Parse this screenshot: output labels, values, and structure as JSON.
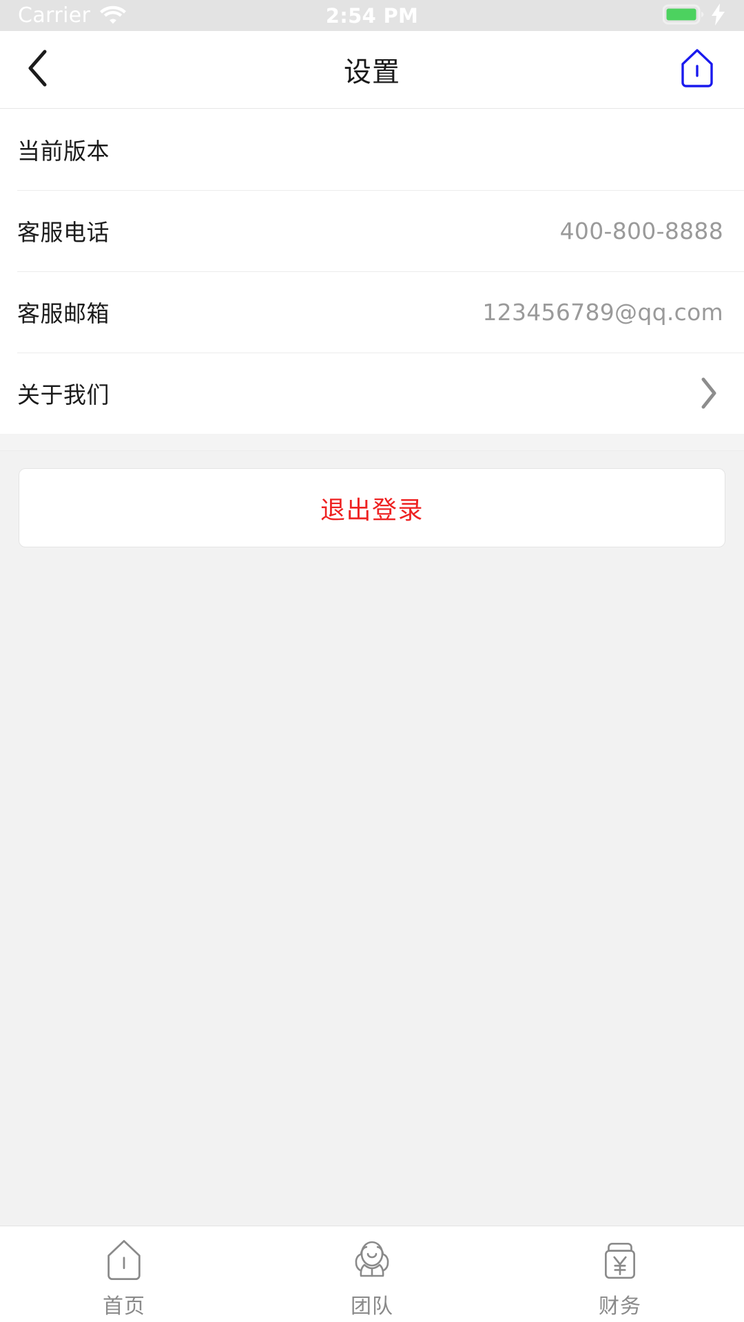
{
  "status_bar": {
    "carrier": "Carrier",
    "wifi_icon": "wifi-icon",
    "time": "2:54 PM",
    "battery_icon": "battery-full-icon",
    "charging_icon": "lightning-bolt-icon",
    "text_color": "#ffffff",
    "background": "#e3e3e3",
    "battery_color": "#4cd25f"
  },
  "nav_bar": {
    "back_icon": "chevron-left-icon",
    "title": "设置",
    "right_icon": "home-outline-icon",
    "right_icon_color": "#1a1aee"
  },
  "settings_list": {
    "rows": [
      {
        "label": "当前版本",
        "value": "",
        "accessory": "none"
      },
      {
        "label": "客服电话",
        "value": "400-800-8888",
        "accessory": "none"
      },
      {
        "label": "客服邮箱",
        "value": "123456789@qq.com",
        "accessory": "none"
      },
      {
        "label": "关于我们",
        "value": "",
        "accessory": "chevron-right-icon"
      }
    ]
  },
  "logout": {
    "label": "退出登录",
    "color": "#ee2222"
  },
  "tab_bar": {
    "tabs": [
      {
        "label": "首页",
        "icon": "home-outline-icon"
      },
      {
        "label": "团队",
        "icon": "team-people-icon"
      },
      {
        "label": "财务",
        "icon": "wallet-yuan-icon"
      }
    ],
    "inactive_color": "#8a8a8a"
  }
}
